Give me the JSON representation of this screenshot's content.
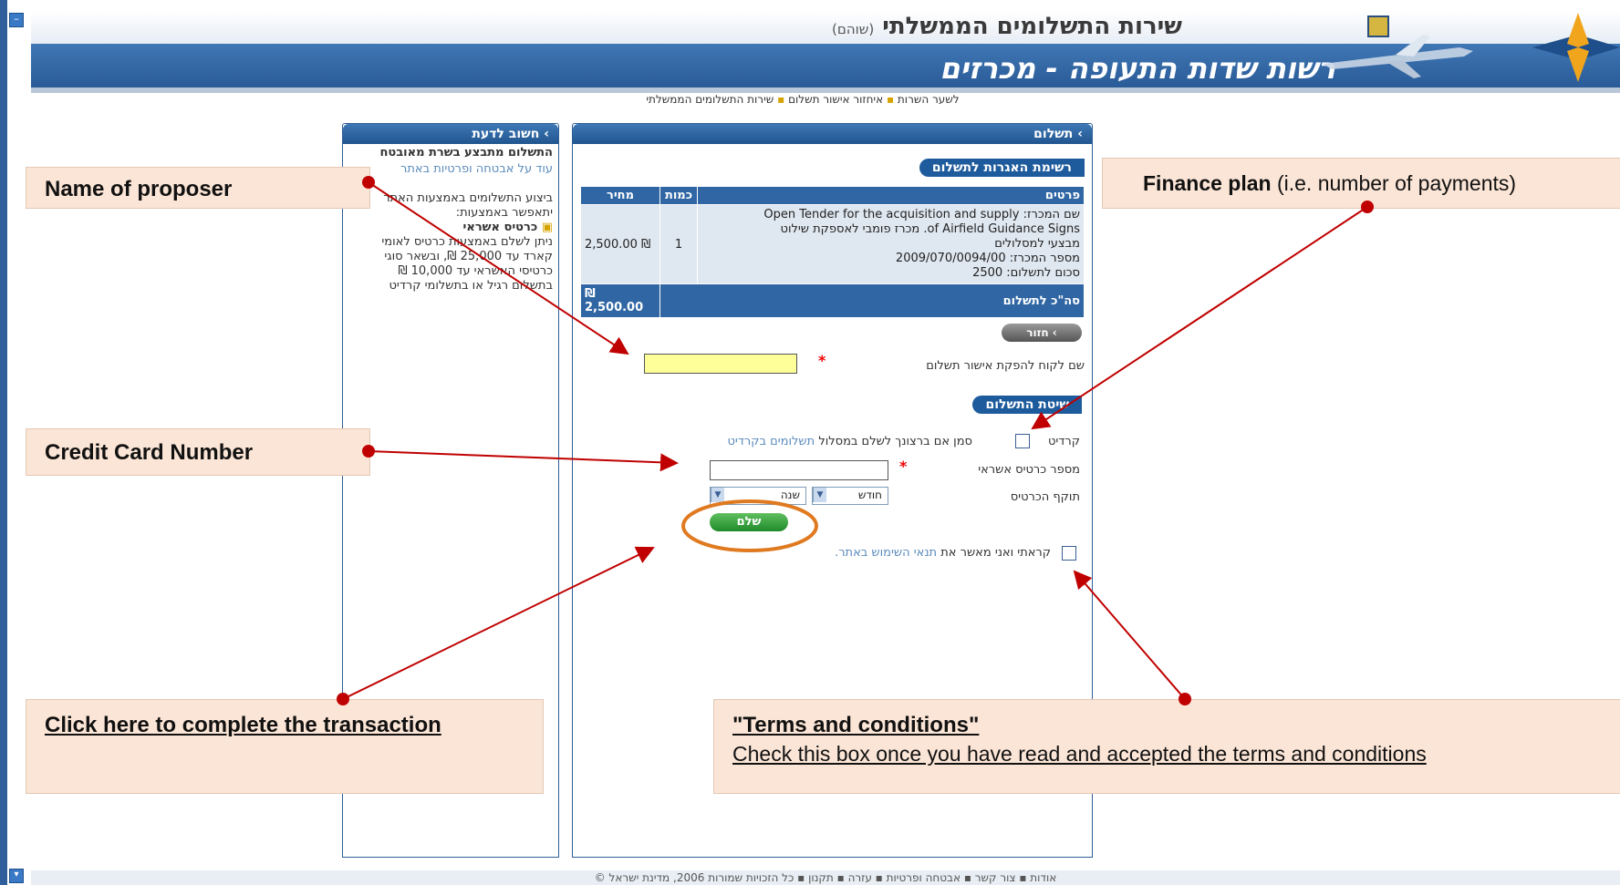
{
  "header": {
    "service_title": "שירות התשלומים הממשלתי",
    "service_subtitle": "(שוהם)",
    "authority_title": "רשות שדות התעופה - מכרזים"
  },
  "breadcrumb": [
    "לשער השרות",
    "איחזור אישור תשלום",
    "שירות התשלומים הממשלתי"
  ],
  "side_panel": {
    "title": "› חשוב לדעת",
    "line1": "התשלום מתבצע בשרת מאובטח",
    "line2": "עוד על אבטחה ופרטיות באתר",
    "line3": "ביצוע התשלומים באמצעות האתר",
    "line4": "יתאפשר באמצעות:",
    "credit_card_title": "כרטיס אשראי",
    "line5": "ניתן לשלם באמצעות כרטיס לאומי",
    "line6": "קארד עד 25,000 ₪, ובשאר סוגי",
    "line7": "כרטיסי האשראי עד 10,000 ₪",
    "line8": "בתשלום רגיל או בתשלומי קרדיט"
  },
  "main_panel": {
    "title": "› תשלום",
    "fees_section": "רשימת האגרות לתשלום",
    "table": {
      "headers": [
        "פרטים",
        "כמות",
        "מחיר"
      ],
      "row_details": [
        "שם המכרז: Open Tender for the acquisition and supply",
        "of Airfield Guidance Signs. מכרז פומבי לאספקת שילוט",
        "מבצעי למסלולים",
        "מספר המכרז: 2009/070/0094/00",
        "סכום לתשלום: 2500"
      ],
      "row_qty": "1",
      "row_price": "₪ 2,500.00",
      "total_label": "סה\"כ לתשלום",
      "total_value": "₪ 2,500.00"
    },
    "back_button": "› חזור",
    "customer_label": "שם לקוח להפקת אישור תשלום",
    "customer_value": "",
    "payment_section": "שיטת התשלום",
    "credit_label": "קרדיט",
    "credit_hint": "סמן אם ברצונך לשלם במסלול",
    "credit_link": "תשלומים בקרדיט",
    "card_number_label": "מספר כרטיס אשראי",
    "card_number_value": "",
    "expiry_label": "תוקף הכרטיס",
    "month_option": "חודש",
    "year_option": "שנה",
    "pay_button": "שלם",
    "terms_prefix": "קראתי ואני מאשר את",
    "terms_link": "תנאי השימוש באתר."
  },
  "callouts": {
    "proposer": "Name of proposer",
    "finance_bold": "Finance plan",
    "finance_rest": " (i.e. number of payments)",
    "card": "Credit Card Number",
    "complete": "Click here to complete the transaction",
    "terms_title": "\"Terms and conditions\"",
    "terms_body": " Check this box once you have read and accepted the terms and conditions"
  },
  "footer": "אודות ▪ צור קשר ▪ אבטחה ופרטיות ▪ עזרה ▪ תקנון ▪ כל הזכויות שמורות 2006, מדינת ישראל ©",
  "colors": {
    "accent_blue": "#2a5b98",
    "callout_bg": "#fbe5d6",
    "annotation_red": "#c00000",
    "highlight_orange": "#e07a20"
  }
}
